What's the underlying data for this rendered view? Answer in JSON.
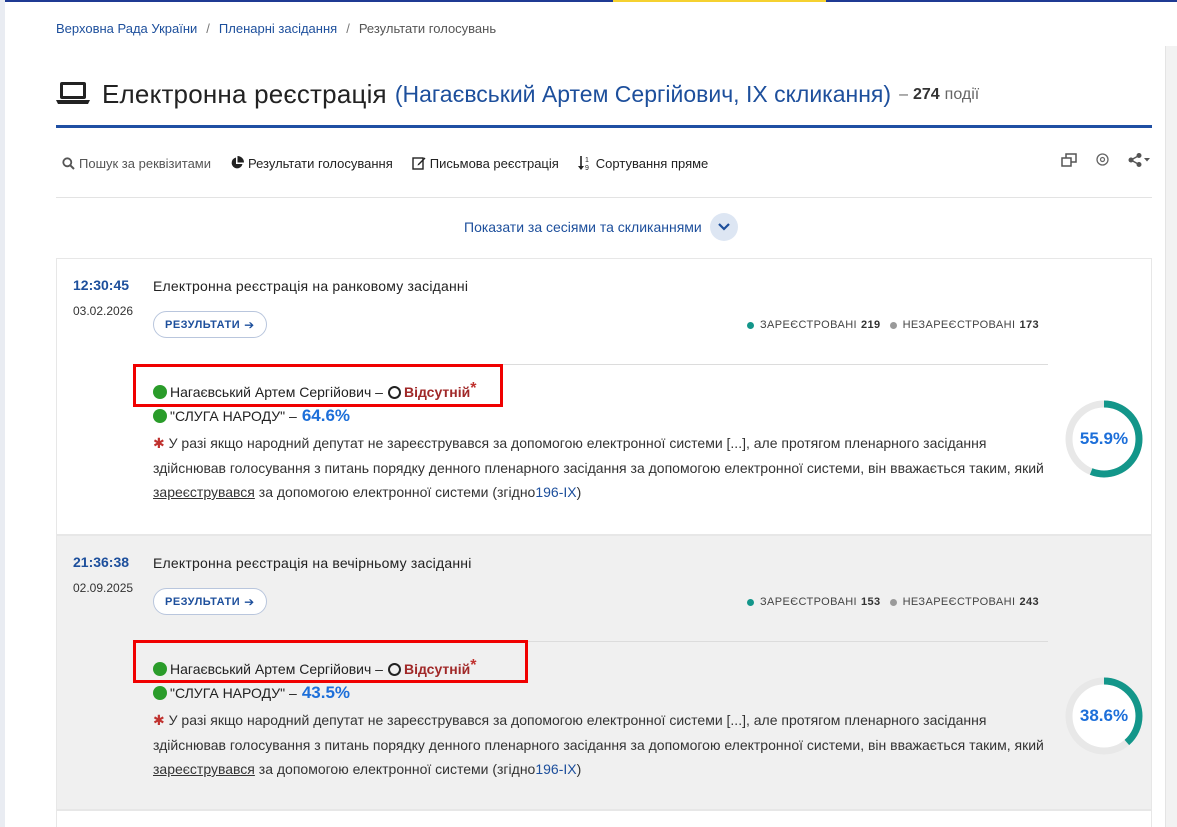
{
  "breadcrumb": [
    "Верховна Рада України",
    "Пленарні засідання",
    "Результати голосувань"
  ],
  "title": {
    "main": "Електронна реєстрація",
    "deputy": "(Нагаєвський Артем Сергійович, IX скликання)",
    "dash": "–",
    "count": "274",
    "events_word": "події"
  },
  "toolbar": {
    "search": "Пошук за реквізитами",
    "results": "Результати голосування",
    "written": "Письмова реєстрація",
    "sort": "Сортування пряме"
  },
  "sessions_toggle": "Показати за сесіями та скликаннями",
  "colors": {
    "accent": "#1d4f9c",
    "registered": "#13968a",
    "unregistered": "#9a9a9a",
    "absent": "#a02828",
    "highlight": "#f00000"
  },
  "events": [
    {
      "time": "12:30:45",
      "date": "03.02.2026",
      "title": "Електронна реєстрація на ранковому засіданні",
      "results_label": "РЕЗУЛЬТАТИ",
      "registered_label": "ЗАРЕЄСТРОВАНІ",
      "registered": "219",
      "unregistered_label": "НЕЗАРЕЄСТРОВАНІ",
      "unregistered": "173",
      "person": "Нагаєвський Артем Сергійович –",
      "status": "Відсутній",
      "star": "*",
      "party": "\"СЛУГА НАРОДУ\" –",
      "party_pct": "64.6%",
      "note_star": "✱",
      "note_part1": "У разі якщо народний депутат не зареєструвався за допомогою електронної системи [...], але протягом пленарного засідання здійснював голосування з питань порядку денного пленарного засідання за допомогою електронної системи, він вважається таким, який",
      "note_link": "зареєструвався",
      "note_part2": "за допомогою електронної системи (згідно",
      "note_law": "196-IX",
      "note_close": ")",
      "gauge_label": "55.9%",
      "gauge_value": 55.9
    },
    {
      "time": "21:36:38",
      "date": "02.09.2025",
      "title": "Електронна реєстрація на вечірньому засіданні",
      "results_label": "РЕЗУЛЬТАТИ",
      "registered_label": "ЗАРЕЄСТРОВАНІ",
      "registered": "153",
      "unregistered_label": "НЕЗАРЕЄСТРОВАНІ",
      "unregistered": "243",
      "person": "Нагаєвський Артем Сергійович –",
      "status": "Відсутній",
      "star": "*",
      "party": "\"СЛУГА НАРОДУ\" –",
      "party_pct": "43.5%",
      "note_star": "✱",
      "note_part1": "У разі якщо народний депутат не зареєструвався за допомогою електронної системи [...], але протягом пленарного засідання здійснював голосування з питань порядку денного пленарного засідання за допомогою електронної системи, він вважається таким, який",
      "note_link": "зареєструвався",
      "note_part2": "за допомогою електронної системи (згідно",
      "note_law": "196-IX",
      "note_close": ")",
      "gauge_label": "38.6%",
      "gauge_value": 38.6
    }
  ]
}
